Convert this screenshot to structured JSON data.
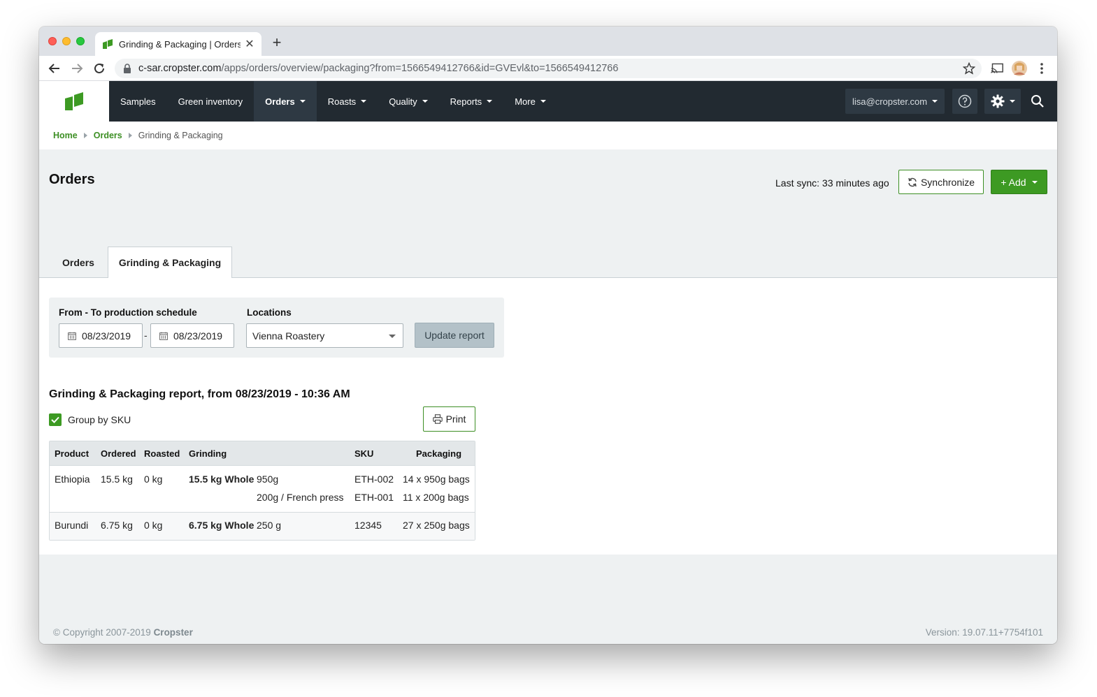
{
  "browser": {
    "tab_title": "Grinding & Packaging | Orders",
    "new_tab_symbol": "+",
    "close_symbol": "✕",
    "url_domain": "c-sar.cropster.com",
    "url_path": "/apps/orders/overview/packaging?from=1566549412766&id=GVEvl&to=1566549412766"
  },
  "nav": {
    "items": [
      {
        "label": "Samples",
        "has_caret": false
      },
      {
        "label": "Green inventory",
        "has_caret": false
      },
      {
        "label": "Orders",
        "has_caret": true,
        "active": true
      },
      {
        "label": "Roasts",
        "has_caret": true
      },
      {
        "label": "Quality",
        "has_caret": true
      },
      {
        "label": "Reports",
        "has_caret": true
      },
      {
        "label": "More",
        "has_caret": true
      }
    ],
    "user": "lisa@cropster.com"
  },
  "breadcrumb": {
    "home": "Home",
    "orders": "Orders",
    "current": "Grinding & Packaging"
  },
  "header": {
    "title": "Orders",
    "last_sync": "Last sync: 33 minutes ago",
    "sync_label": "Synchronize",
    "add_label": "+ Add"
  },
  "tabs": {
    "orders": "Orders",
    "grinding": "Grinding & Packaging"
  },
  "filters": {
    "schedule_label": "From - To production schedule",
    "from_date": "08/23/2019",
    "dash": "-",
    "to_date": "08/23/2019",
    "locations_label": "Locations",
    "location_value": "Vienna Roastery",
    "update_label": "Update report"
  },
  "report": {
    "title": "Grinding & Packaging report, from 08/23/2019 - 10:36 AM",
    "group_label": "Group by SKU",
    "group_checked": true,
    "print_label": "Print",
    "columns": {
      "product": "Product",
      "ordered": "Ordered",
      "roasted": "Roasted",
      "grinding": "Grinding",
      "sku": "SKU",
      "packaging": "Packaging"
    },
    "rows": [
      {
        "product": "Ethiopia",
        "ordered": "15.5 kg",
        "roasted": "0 kg",
        "grinding": "15.5 kg Whole",
        "lines": [
          {
            "size": "950g",
            "sku": "ETH-002",
            "packaging": "14 x 950g bags"
          },
          {
            "size": "200g / French press",
            "sku": "ETH-001",
            "packaging": "11 x 200g bags"
          }
        ]
      },
      {
        "product": "Burundi",
        "ordered": "6.75 kg",
        "roasted": "0 kg",
        "grinding": "6.75 kg Whole",
        "lines": [
          {
            "size": "250 g",
            "sku": "12345",
            "packaging": "27 x 250g bags"
          }
        ]
      }
    ]
  },
  "footer": {
    "copyright_prefix": "© Copyright 2007-2019",
    "brand": "Cropster",
    "version": "Version: 19.07.11+7754f101"
  },
  "colors": {
    "brand_green": "#3d9a23",
    "navbar": "#222a31",
    "link_green": "#3d8f24"
  }
}
